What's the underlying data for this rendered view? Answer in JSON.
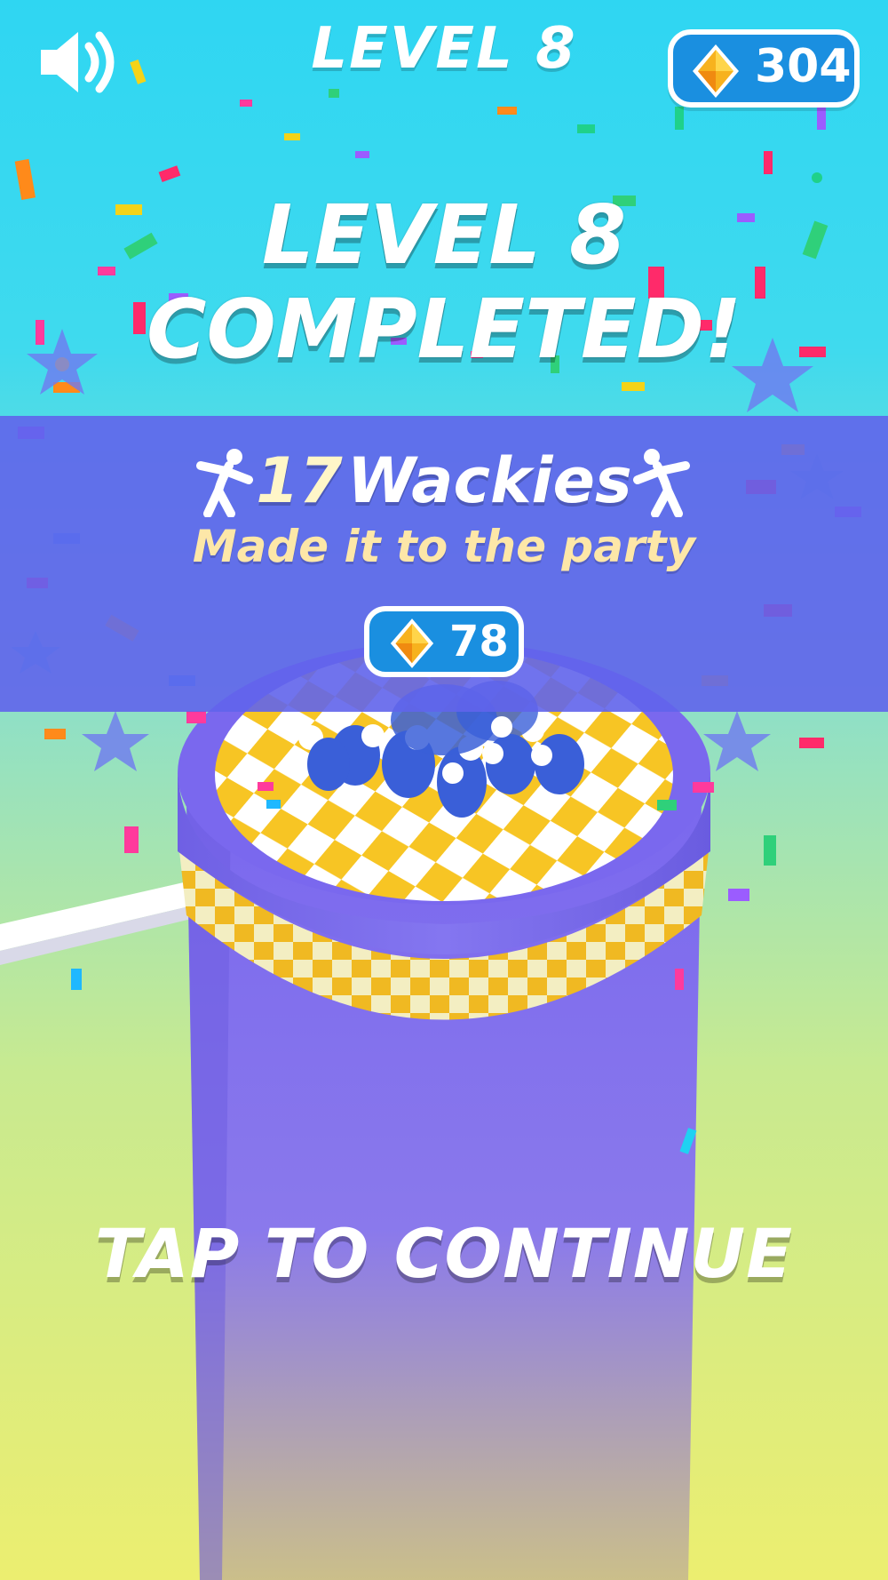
{
  "header": {
    "level_label": "LEVEL 8",
    "gem_count": "304"
  },
  "result": {
    "title_line1": "LEVEL 8",
    "title_line2": "COMPLETED!",
    "wackies_count": "17",
    "wackies_word": "Wackies",
    "subtitle": "Made it to the party",
    "reward_amount": "78"
  },
  "prompt": {
    "tap_label": "TAP TO CONTINUE"
  },
  "colors": {
    "sky_top": "#2fd6f2",
    "ground_bottom": "#ecee70",
    "band": "#6064eb",
    "tower": "#7a68ee",
    "checker_yellow": "#f7c524",
    "gem_button": "#1a8fe0",
    "crowd_blue": "#3a5fd8"
  },
  "icons": {
    "sound": "speaker-on-icon",
    "gem": "diamond-gem-icon",
    "dancer": "dancing-person-icon"
  }
}
